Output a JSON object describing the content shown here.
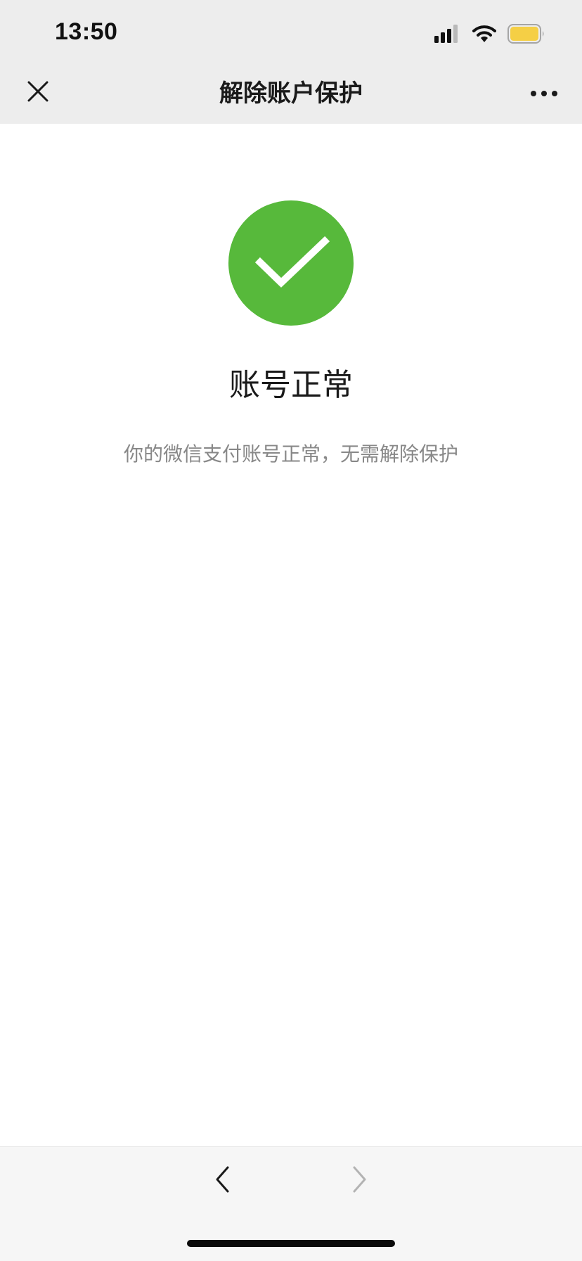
{
  "status_bar": {
    "time": "13:50",
    "icons": [
      "cellular-signal-icon",
      "wifi-icon",
      "battery-icon"
    ],
    "battery_color": "#f5cf45"
  },
  "header": {
    "title": "解除账户保护",
    "close_icon": "close-icon",
    "more_icon": "more-icon"
  },
  "result": {
    "icon": "check-icon",
    "icon_color": "#57b93b",
    "title": "账号正常",
    "description": "你的微信支付账号正常，无需解除保护"
  },
  "bottom_nav": {
    "back_icon": "chevron-left-icon",
    "forward_icon": "chevron-right-icon",
    "forward_enabled": false
  }
}
